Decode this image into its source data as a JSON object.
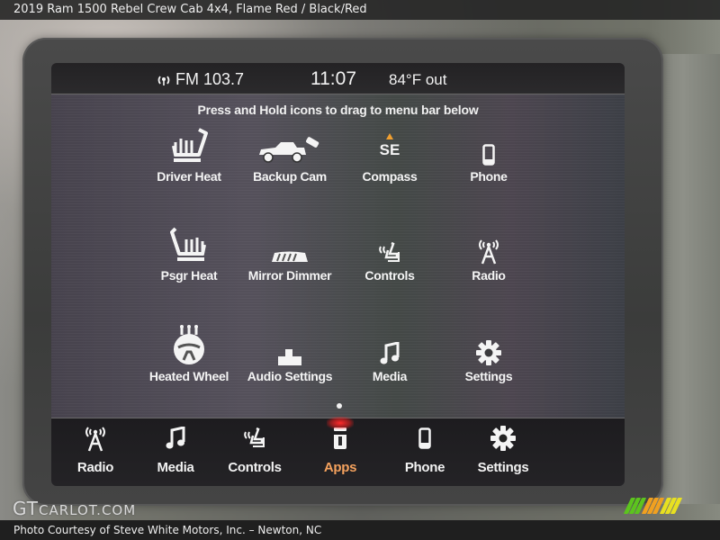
{
  "caption": {
    "title": "2019 Ram 1500 Rebel Crew Cab 4x4,  Flame Red / Black/Red",
    "credit": "Photo Courtesy of Steve White Motors, Inc. – Newton, NC",
    "watermark_big": "GT",
    "watermark_small": "CARLOT.COM"
  },
  "status": {
    "radio_icon": "radio-signal-icon",
    "radio": "FM 103.7",
    "time": "11:07",
    "temperature": "84°F out"
  },
  "hint": "Press and Hold icons to drag to menu bar below",
  "apps": [
    {
      "label": "Driver Heat",
      "icon": "heated-seat-icon"
    },
    {
      "label": "Backup Cam",
      "icon": "truck-tailgate-icon"
    },
    {
      "label": "Compass",
      "icon": "compass-icon",
      "heading": "SE"
    },
    {
      "label": "Phone",
      "icon": "phone-icon"
    },
    {
      "label": "Psgr Heat",
      "icon": "heated-seat-icon"
    },
    {
      "label": "Mirror Dimmer",
      "icon": "mirror-icon"
    },
    {
      "label": "Controls",
      "icon": "controls-icon"
    },
    {
      "label": "Radio",
      "icon": "radio-tower-icon"
    },
    {
      "label": "Heated Wheel",
      "icon": "heated-wheel-icon"
    },
    {
      "label": "Audio Settings",
      "icon": "audio-settings-icon"
    },
    {
      "label": "Media",
      "icon": "music-note-icon"
    },
    {
      "label": "Settings",
      "icon": "gear-icon"
    }
  ],
  "menu_bar": [
    {
      "label": "Radio",
      "icon": "radio-tower-icon",
      "active": false
    },
    {
      "label": "Media",
      "icon": "music-note-icon",
      "active": false
    },
    {
      "label": "Controls",
      "icon": "controls-icon",
      "active": false
    },
    {
      "label": "Apps",
      "icon": "apps-icon",
      "active": true
    },
    {
      "label": "Phone",
      "icon": "phone-icon",
      "active": false
    },
    {
      "label": "Settings",
      "icon": "gear-icon",
      "active": false
    }
  ],
  "colors": {
    "active_label": "#f5a25e",
    "active_glow": "#ff2a2a",
    "compass_marker": "#f0a030",
    "stripes": [
      "#5cc41e",
      "#f0a020",
      "#e8e020"
    ]
  }
}
